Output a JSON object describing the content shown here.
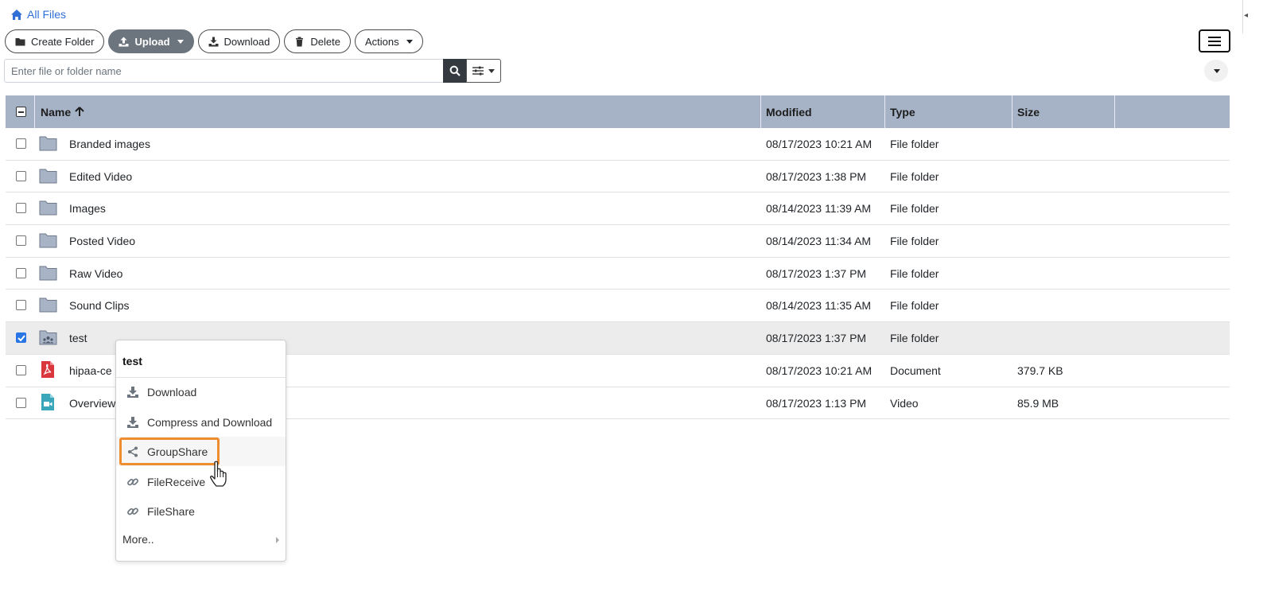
{
  "breadcrumb": {
    "label": "All Files"
  },
  "toolbar": {
    "create_folder": "Create Folder",
    "upload": "Upload",
    "download": "Download",
    "delete": "Delete",
    "actions": "Actions"
  },
  "search": {
    "placeholder": "Enter file or folder name"
  },
  "table": {
    "headers": {
      "name": "Name",
      "modified": "Modified",
      "type": "Type",
      "size": "Size"
    },
    "rows": [
      {
        "name": "Branded images",
        "modified": "08/17/2023 10:21 AM",
        "type": "File folder",
        "size": "",
        "icon": "folder-icon",
        "selected": false
      },
      {
        "name": "Edited Video",
        "modified": "08/17/2023 1:38 PM",
        "type": "File folder",
        "size": "",
        "icon": "folder-icon",
        "selected": false
      },
      {
        "name": "Images",
        "modified": "08/14/2023 11:39 AM",
        "type": "File folder",
        "size": "",
        "icon": "folder-icon",
        "selected": false
      },
      {
        "name": "Posted Video",
        "modified": "08/14/2023 11:34 AM",
        "type": "File folder",
        "size": "",
        "icon": "folder-icon",
        "selected": false
      },
      {
        "name": "Raw Video",
        "modified": "08/17/2023 1:37 PM",
        "type": "File folder",
        "size": "",
        "icon": "folder-icon",
        "selected": false
      },
      {
        "name": "Sound Clips",
        "modified": "08/14/2023 11:35 AM",
        "type": "File folder",
        "size": "",
        "icon": "folder-icon",
        "selected": false
      },
      {
        "name": "test",
        "modified": "08/17/2023 1:37 PM",
        "type": "File folder",
        "size": "",
        "icon": "shared-folder-icon",
        "selected": true
      },
      {
        "name": "hipaa-ce",
        "modified": "08/17/2023 10:21 AM",
        "type": "Document",
        "size": "379.7 KB",
        "icon": "pdf-icon",
        "selected": false
      },
      {
        "name": "Overview",
        "modified": "08/17/2023 1:13 PM",
        "type": "Video",
        "size": "85.9 MB",
        "icon": "video-file-icon",
        "selected": false
      }
    ]
  },
  "context_menu": {
    "title": "test",
    "items": [
      {
        "label": "Download",
        "icon": "download-icon"
      },
      {
        "label": "Compress and Download",
        "icon": "download-icon"
      },
      {
        "label": "GroupShare",
        "icon": "share-icon"
      },
      {
        "label": "FileReceive",
        "icon": "link-icon"
      },
      {
        "label": "FileShare",
        "icon": "link-icon"
      }
    ],
    "more": "More.."
  },
  "colors": {
    "accent": "#2f6fd6",
    "header_bg": "#a6b3c7",
    "highlight": "#ef8c2d",
    "folder": "#a8b3c5",
    "pdf": "#d9363e",
    "video": "#3aa6b9"
  }
}
